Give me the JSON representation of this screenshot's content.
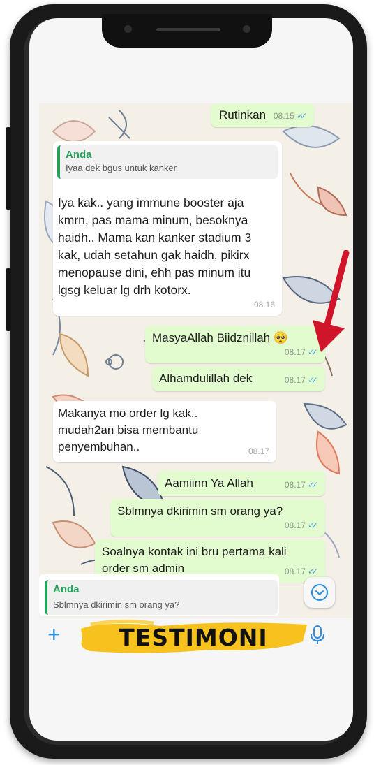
{
  "messages": [
    {
      "dir": "out",
      "text": "Rutinkan",
      "time": "08.15",
      "ticks": "✓✓"
    },
    {
      "dir": "in",
      "quote_author": "Anda",
      "quote_text": "Iyaa dek bgus untuk kanker",
      "text": "Iya kak.. yang immune booster aja\nkmrn, pas mama minum, besoknya\nhaidh.. Mama kan kanker stadium 3\nkak, udah setahun gak haidh, pikirx\nmenopause dini, ehh pas minum itu\nlgsg keluar lg drh kotorx.",
      "time": "08.16"
    },
    {
      "dir": "out",
      "text": "MasyaAllah Biidznillah 🥺",
      "time": "08.17",
      "ticks": "✓✓"
    },
    {
      "dir": "out",
      "text": "Alhamdulillah dek",
      "time": "08.17",
      "ticks": "✓✓"
    },
    {
      "dir": "in",
      "text": "Makanya mo order lg kak..\nmudah2an bisa membantu\npenyembuhan..",
      "time": "08.17"
    },
    {
      "dir": "out",
      "text": "Aamiinn Ya Allah",
      "time": "08.17",
      "ticks": "✓✓"
    },
    {
      "dir": "out",
      "text": "Sblmnya dkirimin sm orang ya?",
      "time": "08.17",
      "ticks": "✓✓"
    },
    {
      "dir": "out",
      "text": "Soalnya kontak ini bru pertama kali\norder sm admin",
      "time": "08.17",
      "ticks": "✓✓"
    }
  ],
  "reply_preview": {
    "author": "Anda",
    "text": "Sblmnya dkirimin sm orang ya?"
  },
  "banner": {
    "text": "TESTIMONI"
  },
  "input": {
    "plus_icon": "plus-icon",
    "mic_icon": "microphone-icon"
  },
  "colors": {
    "outgoing": "#e2fbcf",
    "incoming": "#ffffff",
    "accent": "#25a35a",
    "ticks": "#4fa7e8",
    "arrow": "#d0142a",
    "banner_highlight": "#f7c21d"
  }
}
